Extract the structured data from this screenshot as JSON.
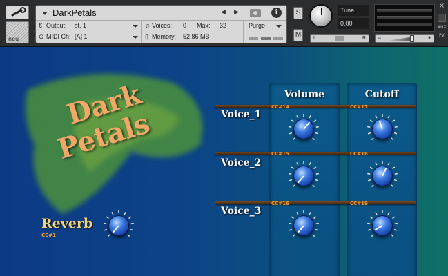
{
  "header": {
    "instrument_name": "DarkPetals",
    "output_label": "Output:",
    "output_value": "st. 1",
    "voices_label": "Voices:",
    "voices_value": "0",
    "max_label": "Max:",
    "max_value": "32",
    "purge_label": "Purge",
    "midi_label": "MIDI Ch:",
    "midi_value": "[A]  1",
    "memory_label": "Memory:",
    "memory_value": "52.86 MB",
    "info_label": "i",
    "solo_label": "S",
    "mute_label": "M",
    "tune_label": "Tune",
    "tune_value": "0.00",
    "pan_left": "L",
    "pan_right": "R",
    "pan_center": "◆",
    "vol_minus": "−",
    "vol_plus": "+",
    "logo_text": "neu",
    "close_label": "×",
    "aux_label": "AUX",
    "pv_label": "PV"
  },
  "instrument": {
    "title_line1": "Dark",
    "title_line2": "Petals",
    "column_headers": [
      "Volume",
      "Cutoff"
    ],
    "voices": [
      {
        "label": "Voice_1",
        "volume_cc": "CC#14",
        "cutoff_cc": "CC#17"
      },
      {
        "label": "Voice_2",
        "volume_cc": "CC#15",
        "cutoff_cc": "CC#18"
      },
      {
        "label": "Voice_3",
        "volume_cc": "CC#16",
        "cutoff_cc": "CC#19"
      }
    ],
    "reverb_label": "Reverb",
    "reverb_cc": "CC#1"
  },
  "colors": {
    "title": "#f0a868",
    "reverb_label": "#f4d27a",
    "cc_label": "#f0a030",
    "knob_blue": "#1f5ad0"
  }
}
